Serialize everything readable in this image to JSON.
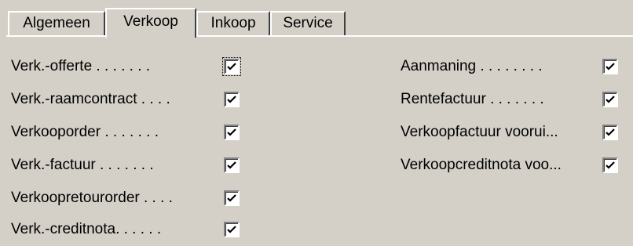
{
  "tabs": [
    {
      "label": "Algemeen",
      "active": false
    },
    {
      "label": "Verkoop",
      "active": true
    },
    {
      "label": "Inkoop",
      "active": false
    },
    {
      "label": "Service",
      "active": false
    }
  ],
  "left_checks": [
    {
      "label": "Verk.-offerte . . . . . . .",
      "checked": true
    },
    {
      "label": "Verk.-raamcontract . . . .",
      "checked": true
    },
    {
      "label": "Verkooporder . . . . . . .",
      "checked": true
    },
    {
      "label": "Verk.-factuur . . . . . . .",
      "checked": true
    },
    {
      "label": "Verkoopretourorder . . . .",
      "checked": true
    },
    {
      "label": "Verk.-creditnota. . . . . .",
      "checked": true
    }
  ],
  "right_checks": [
    {
      "label": "Aanmaning . . . . . . . .",
      "checked": true
    },
    {
      "label": "Rentefactuur . . . . . . .",
      "checked": true
    },
    {
      "label": "Verkoopfactuur voorui...",
      "checked": true
    },
    {
      "label": "Verkoopcreditnota voo...",
      "checked": true
    }
  ]
}
